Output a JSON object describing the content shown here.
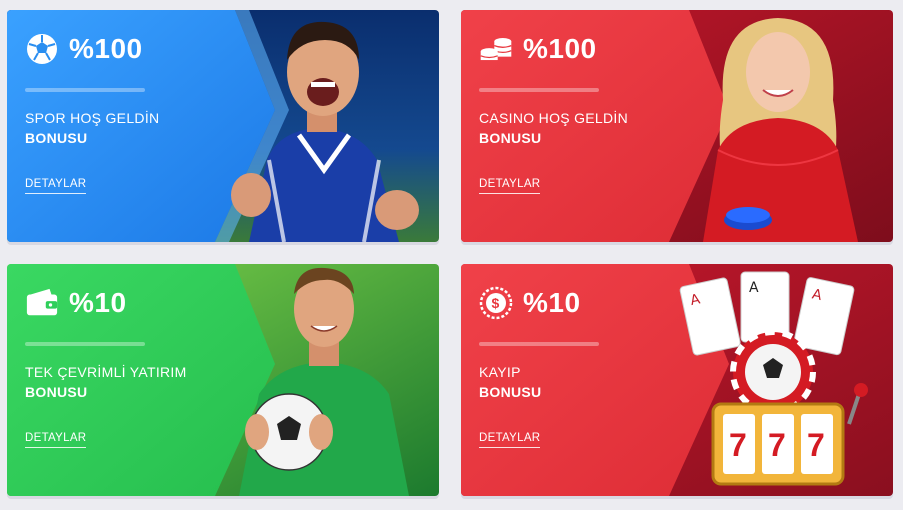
{
  "cards": [
    {
      "percent": "%100",
      "title_line1": "SPOR HOŞ GELDİN",
      "title_line2": "BONUSU",
      "details_label": "DETAYLAR",
      "icon": "soccer-ball-icon",
      "theme": "blue",
      "color": "#2a8ef0",
      "accent": "#1f6fd6"
    },
    {
      "percent": "%100",
      "title_line1": "CASINO HOŞ GELDİN",
      "title_line2": "BONUSU",
      "details_label": "DETAYLAR",
      "icon": "coin-stack-icon",
      "theme": "red",
      "color": "#e8383f",
      "accent": "#c41f2b"
    },
    {
      "percent": "%10",
      "title_line1": "TEK ÇEVRİMLİ YATIRIM",
      "title_line2": "BONUSU",
      "details_label": "DETAYLAR",
      "icon": "wallet-icon",
      "theme": "green",
      "color": "#2fcf5a",
      "accent": "#1fae43"
    },
    {
      "percent": "%10",
      "title_line1": "KAYIP",
      "title_line2": "BONUSU",
      "details_label": "DETAYLAR",
      "icon": "dollar-coin-icon",
      "theme": "red",
      "color": "#e8383f",
      "accent": "#b8182a"
    }
  ]
}
